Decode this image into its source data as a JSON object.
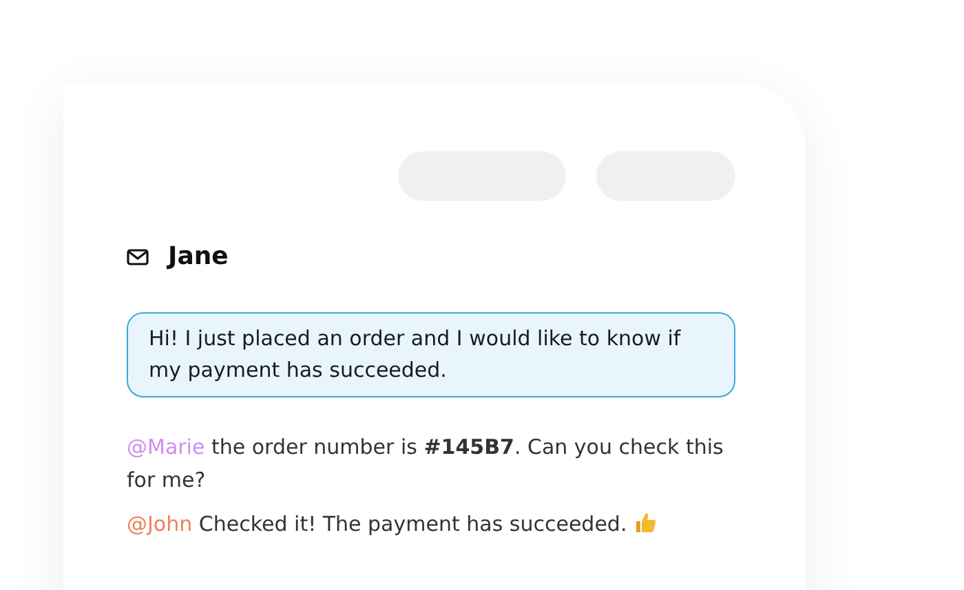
{
  "card": {
    "placeholders": [
      {
        "kind": "pill"
      },
      {
        "kind": "pill"
      }
    ],
    "sender": {
      "name": "Jane"
    },
    "message": {
      "text": "Hi! I just placed an order and I would like to know if my payment has succeeded."
    },
    "notes": [
      {
        "mention": "@Marie",
        "color": "#d08ef0",
        "text": "the order number is **#145B7**. Can you check this for me?",
        "reaction": false
      },
      {
        "mention": "@John",
        "color": "#f0805a",
        "text": "Checked it! The payment has succeeded.",
        "reaction": true
      }
    ]
  }
}
